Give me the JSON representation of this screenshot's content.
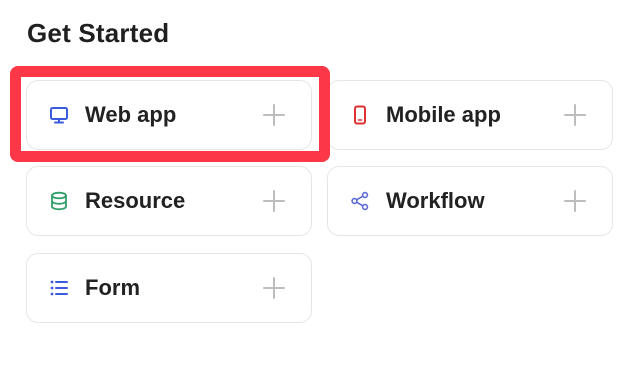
{
  "section": {
    "title": "Get Started"
  },
  "cards": [
    {
      "label": "Web app",
      "icon": "monitor-icon",
      "color": "#3b5bdb"
    },
    {
      "label": "Mobile app",
      "icon": "mobile-phone-icon",
      "color": "#e03131"
    },
    {
      "label": "Resource",
      "icon": "database-icon",
      "color": "#2f9e69"
    },
    {
      "label": "Workflow",
      "icon": "share-nodes-icon",
      "color": "#5c6bd6"
    },
    {
      "label": "Form",
      "icon": "list-icon",
      "color": "#3b5bdb"
    }
  ],
  "colors": {
    "highlight": "#fb3748",
    "plus": "#bdbdbd",
    "card_border": "#e6e6e6"
  }
}
